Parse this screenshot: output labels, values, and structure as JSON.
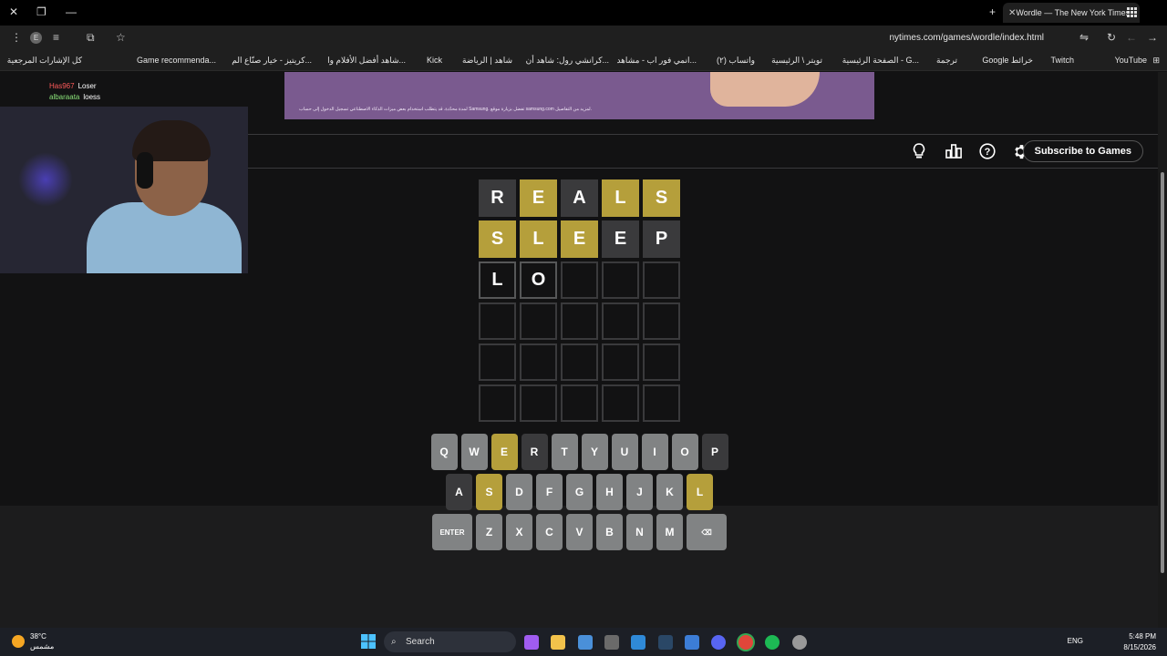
{
  "browser": {
    "tab_title": "Wordle — The New York Times",
    "url": "nytimes.com/games/wordle/index.html",
    "profile_initial": "E",
    "bookmarks": [
      "YouTube",
      "Twitch",
      "Google خرائط",
      "ترجمة",
      "الصفحة الرئيسية - G...",
      "تويتر \\ الرئيسية",
      "(٢) واتساب",
      "انمي فور اب - مشاهد...",
      "كرانشي رول: شاهد أن...",
      "شاهد | الرياضة",
      "Kick",
      "شاهد أفضل الأفلام وا...",
      "كريتيز - خيار صنّاع الم...",
      "Game recommenda...",
      "كل الإشارات المرجعية"
    ]
  },
  "ad": {
    "text": "لمدة محدّدة. قد يتطلب استخدام بعض ميزات الذكاء الاصطناعي تسجيل الدخول إلى حساب Samsung. تفضل بزيارة موقع samsung.com لمزيد من التفاصيل."
  },
  "header": {
    "subscribe_label": "Subscribe to Games"
  },
  "board": [
    [
      {
        "l": "R",
        "s": "absent"
      },
      {
        "l": "E",
        "s": "present"
      },
      {
        "l": "A",
        "s": "absent"
      },
      {
        "l": "L",
        "s": "present"
      },
      {
        "l": "S",
        "s": "present"
      }
    ],
    [
      {
        "l": "S",
        "s": "present"
      },
      {
        "l": "L",
        "s": "present"
      },
      {
        "l": "E",
        "s": "present"
      },
      {
        "l": "E",
        "s": "absent"
      },
      {
        "l": "P",
        "s": "absent"
      }
    ],
    [
      {
        "l": "L",
        "s": "tbd"
      },
      {
        "l": "O",
        "s": "tbd"
      },
      {
        "l": "",
        "s": "empty"
      },
      {
        "l": "",
        "s": "empty"
      },
      {
        "l": "",
        "s": "empty"
      }
    ],
    [
      {
        "l": "",
        "s": "empty"
      },
      {
        "l": "",
        "s": "empty"
      },
      {
        "l": "",
        "s": "empty"
      },
      {
        "l": "",
        "s": "empty"
      },
      {
        "l": "",
        "s": "empty"
      }
    ],
    [
      {
        "l": "",
        "s": "empty"
      },
      {
        "l": "",
        "s": "empty"
      },
      {
        "l": "",
        "s": "empty"
      },
      {
        "l": "",
        "s": "empty"
      },
      {
        "l": "",
        "s": "empty"
      }
    ],
    [
      {
        "l": "",
        "s": "empty"
      },
      {
        "l": "",
        "s": "empty"
      },
      {
        "l": "",
        "s": "empty"
      },
      {
        "l": "",
        "s": "empty"
      },
      {
        "l": "",
        "s": "empty"
      }
    ]
  ],
  "keyboard": [
    [
      {
        "k": "Q"
      },
      {
        "k": "W"
      },
      {
        "k": "E",
        "s": "present"
      },
      {
        "k": "R",
        "s": "absent"
      },
      {
        "k": "T"
      },
      {
        "k": "Y"
      },
      {
        "k": "U"
      },
      {
        "k": "I"
      },
      {
        "k": "O"
      },
      {
        "k": "P",
        "s": "absent"
      }
    ],
    [
      {
        "k": "A",
        "s": "absent"
      },
      {
        "k": "S",
        "s": "present"
      },
      {
        "k": "D"
      },
      {
        "k": "F"
      },
      {
        "k": "G"
      },
      {
        "k": "H"
      },
      {
        "k": "J"
      },
      {
        "k": "K"
      },
      {
        "k": "L",
        "s": "present"
      }
    ],
    [
      {
        "k": "ENTER",
        "wide": true
      },
      {
        "k": "Z"
      },
      {
        "k": "X"
      },
      {
        "k": "C"
      },
      {
        "k": "V"
      },
      {
        "k": "B"
      },
      {
        "k": "N"
      },
      {
        "k": "M"
      },
      {
        "k": "⌫",
        "wide": true
      }
    ]
  ],
  "chat": [
    {
      "name": "Has967",
      "msg": "Loser"
    },
    {
      "name": "albaraata",
      "msg": "loess"
    }
  ],
  "taskbar": {
    "temp": "38°C",
    "weather": "مشمس",
    "search_label": "Search",
    "lang": "ENG",
    "time": "5:48 PM",
    "date": "8/15/2026"
  },
  "colors": {
    "present": "#b59f3b",
    "absent": "#3a3a3c",
    "correct": "#538d4e",
    "background": "#121213"
  }
}
